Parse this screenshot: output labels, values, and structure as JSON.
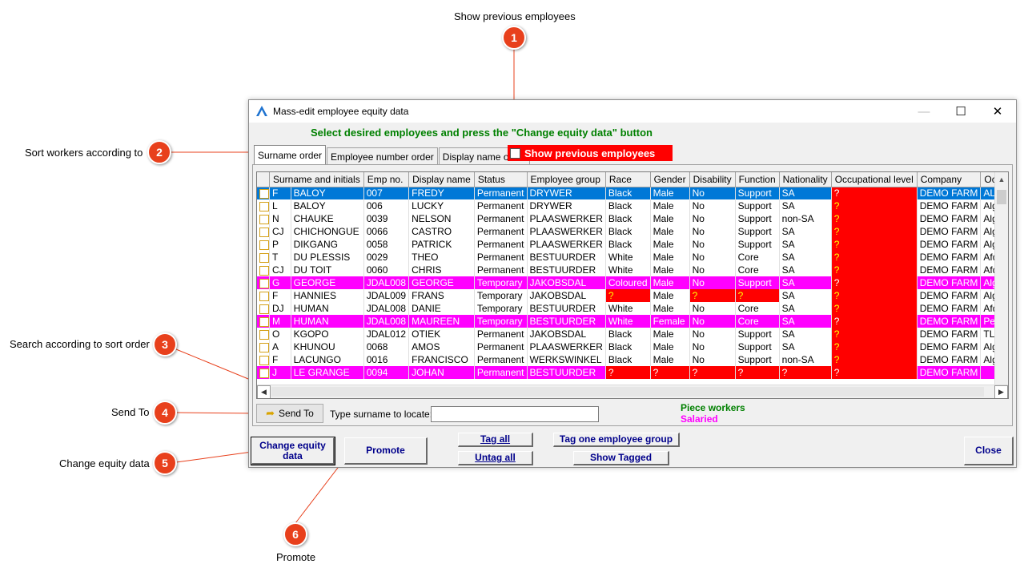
{
  "annotations": [
    {
      "num": "1",
      "label": "Show previous employees"
    },
    {
      "num": "2",
      "label": "Sort workers according to"
    },
    {
      "num": "3",
      "label": "Search according to sort order"
    },
    {
      "num": "4",
      "label": "Send To"
    },
    {
      "num": "5",
      "label": "Change equity data"
    },
    {
      "num": "6",
      "label": "Promote"
    }
  ],
  "window": {
    "title": "Mass-edit employee equity data",
    "minimize": "—",
    "maximize": "☐",
    "close": "✕"
  },
  "instruction": "Select desired employees and press the \"Change equity data\" button",
  "tabs": [
    "Surname order",
    "Employee number order",
    "Display name order"
  ],
  "show_previous_label": "Show previous employees",
  "grid": {
    "columns": [
      "",
      "Surname and initials",
      "",
      "Emp no.",
      "Display name",
      "Status",
      "Employee group",
      "Race",
      "Gender",
      "Disability",
      "Function",
      "Nationality",
      "Occupational level",
      "Company",
      "Occupation"
    ],
    "rows": [
      {
        "style": "sel",
        "cells": [
          "F",
          "BALOY",
          "007",
          "FREDY",
          "Permanent",
          "DRYWER",
          "Black",
          "Male",
          "No",
          "Support",
          "SA",
          "?",
          "DEMO FARM",
          "ALGEMENE WERKER"
        ]
      },
      {
        "style": "",
        "cells": [
          "L",
          "BALOY",
          "006",
          "LUCKY",
          "Permanent",
          "DRYWER",
          "Black",
          "Male",
          "No",
          "Support",
          "SA",
          "?",
          "DEMO FARM",
          "Algemene werker"
        ]
      },
      {
        "style": "",
        "cells": [
          "N",
          "CHAUKE",
          "0039",
          "NELSON",
          "Permanent",
          "PLAASWERKER",
          "Black",
          "Male",
          "No",
          "Support",
          "non-SA",
          "?",
          "DEMO FARM",
          "Algemene werker"
        ]
      },
      {
        "style": "",
        "cells": [
          "CJ",
          "CHICHONGUE",
          "0066",
          "CASTRO",
          "Permanent",
          "PLAASWERKER",
          "Black",
          "Male",
          "No",
          "Support",
          "SA",
          "?",
          "DEMO FARM",
          "Algemene werker"
        ]
      },
      {
        "style": "",
        "cells": [
          "P",
          "DIKGANG",
          "0058",
          "PATRICK",
          "Permanent",
          "PLAASWERKER",
          "Black",
          "Male",
          "No",
          "Support",
          "SA",
          "?",
          "DEMO FARM",
          "Algemene werker"
        ]
      },
      {
        "style": "",
        "cells": [
          "T",
          "DU PLESSIS",
          "0029",
          "THEO",
          "Permanent",
          "BESTUURDER",
          "White",
          "Male",
          "No",
          "Core",
          "SA",
          "?",
          "DEMO FARM",
          "Afdelings Bestuurder"
        ]
      },
      {
        "style": "",
        "cells": [
          "CJ",
          "DU TOIT",
          "0060",
          "CHRIS",
          "Permanent",
          "BESTUURDER",
          "White",
          "Male",
          "No",
          "Core",
          "SA",
          "?",
          "DEMO FARM",
          "Afdelings Bestuurder"
        ]
      },
      {
        "style": "mag",
        "cells": [
          "G",
          "GEORGE",
          "JDAL008",
          "GEORGE",
          "Temporary",
          "JAKOBSDAL",
          "Coloured",
          "Male",
          "No",
          "Support",
          "SA",
          "?",
          "DEMO FARM",
          "Algemene werker"
        ]
      },
      {
        "style": "",
        "cells": [
          "F",
          "HANNIES",
          "JDAL009",
          "FRANS",
          "Temporary",
          "JAKOBSDAL",
          "?",
          "Male",
          "?",
          "?",
          "SA",
          "?",
          "DEMO FARM",
          "Algemene werker"
        ]
      },
      {
        "style": "",
        "cells": [
          "DJ",
          "HUMAN",
          "JDAL008",
          "DANIE",
          "Temporary",
          "BESTUURDER",
          "White",
          "Male",
          "No",
          "Core",
          "SA",
          "?",
          "DEMO FARM",
          "Afdelings Bestuurder"
        ]
      },
      {
        "style": "mag",
        "cells": [
          "M",
          "HUMAN",
          "JDAL008",
          "MAUREEN",
          "Temporary",
          "BESTUURDER",
          "White",
          "Female",
          "No",
          "Core",
          "SA",
          "?",
          "DEMO FARM",
          "Persoonlike Assistent"
        ]
      },
      {
        "style": "",
        "cells": [
          "O",
          "KGOPO",
          "JDAL012",
          "OTIEK",
          "Permanent",
          "JAKOBSDAL",
          "Black",
          "Male",
          "No",
          "Support",
          "SA",
          "?",
          "DEMO FARM",
          "TLB Drywer"
        ]
      },
      {
        "style": "",
        "cells": [
          "A",
          "KHUNOU",
          "0068",
          "AMOS",
          "Permanent",
          "PLAASWERKER",
          "Black",
          "Male",
          "No",
          "Support",
          "SA",
          "?",
          "DEMO FARM",
          "Algemene werker"
        ]
      },
      {
        "style": "",
        "cells": [
          "F",
          "LACUNGO",
          "0016",
          "FRANCISCO",
          "Permanent",
          "WERKSWINKEL",
          "Black",
          "Male",
          "No",
          "Support",
          "non-SA",
          "?",
          "DEMO FARM",
          "Algemene werker"
        ]
      },
      {
        "style": "mag",
        "cells": [
          "J",
          "LE GRANGE",
          "0094",
          "JOHAN",
          "Permanent",
          "BESTUURDER",
          "?",
          "?",
          "?",
          "?",
          "?",
          "?",
          "DEMO FARM",
          ""
        ]
      }
    ]
  },
  "send_to_label": "Send To",
  "locate_label": "Type surname to locate:",
  "locate_value": "",
  "legend": {
    "piece": "Piece workers",
    "salaried": "Salaried"
  },
  "buttons": {
    "change_equity": "Change equity data",
    "promote": "Promote",
    "tag_all": "Tag all",
    "untag_all": "Untag all",
    "tag_group": "Tag one employee group",
    "show_tagged": "Show Tagged",
    "close": "Close"
  },
  "colors": {
    "badge": "#e8401c",
    "selected_row": "#0078d7",
    "salaried": "#ff00ff",
    "piece_workers": "#008000",
    "missing": "#ff0000",
    "button_text": "#00008b"
  }
}
